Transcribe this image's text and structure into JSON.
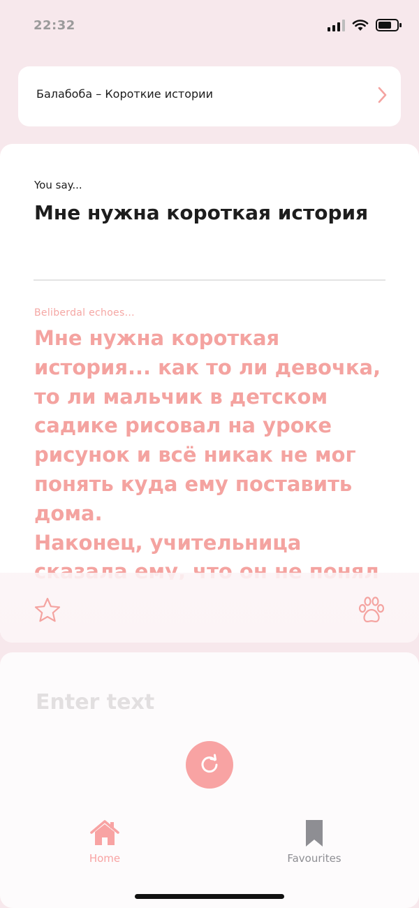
{
  "status_bar": {
    "time": "22:32"
  },
  "style_selector": {
    "label": "Балабоба – Короткие истории"
  },
  "prompt": {
    "label": "You say...",
    "text": "Мне нужна короткая история"
  },
  "result": {
    "label": "Beliberdal echoes...",
    "text": "Мне нужна короткая история... как то ли девочка, то ли мальчик в детском садике рисовал на уроке рисунок и всё никак не мог понять куда ему поставить дома.\nНаконец, учительница сказала ему, что он не понял"
  },
  "input": {
    "placeholder": "Enter text",
    "value": ""
  },
  "tab_bar": {
    "home_label": "Home",
    "favourites_label": "Favourites"
  },
  "colors": {
    "accent": "#f8a3a3",
    "background": "#f7e8ec",
    "inactive": "#8e8e93"
  }
}
